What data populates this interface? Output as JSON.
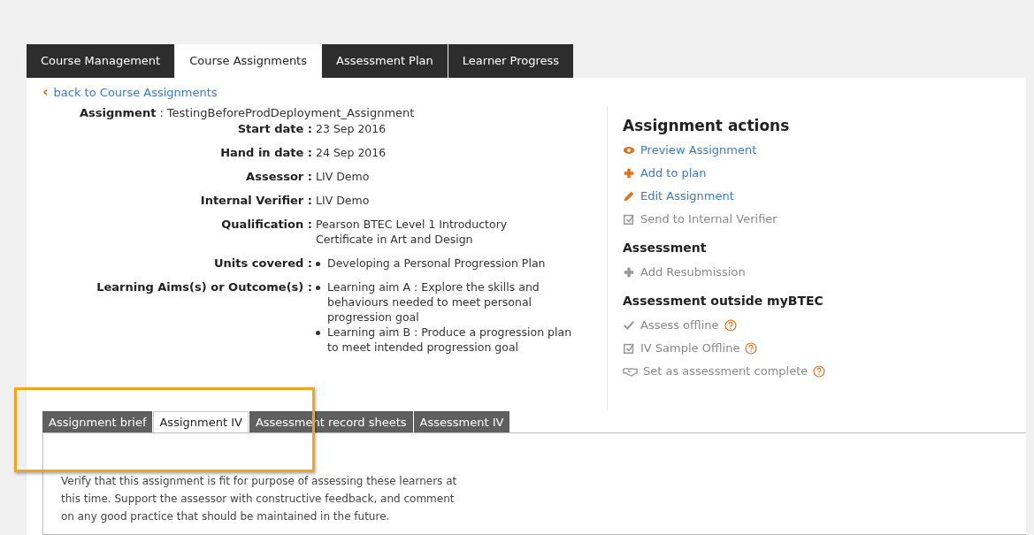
{
  "main_tabs": [
    {
      "label": "Course Management",
      "selected": false
    },
    {
      "label": "Course Assignments",
      "selected": true
    },
    {
      "label": "Assessment Plan",
      "selected": false
    },
    {
      "label": "Learner Progress",
      "selected": false
    }
  ],
  "back_link": {
    "icon": "‹",
    "label": "back to Course Assignments"
  },
  "assignment": {
    "label": "Assignment",
    "separator": ":",
    "value": "TestingBeforeProdDeployment_Assignment"
  },
  "details": [
    {
      "label": "Start date",
      "separator": ":",
      "value": "23 Sep 2016",
      "kind": "text"
    },
    {
      "label": "Hand in date",
      "separator": ":",
      "value": "24 Sep 2016",
      "kind": "text"
    },
    {
      "label": "Assessor",
      "separator": ":",
      "value": "LIV Demo",
      "kind": "text"
    },
    {
      "label": "Internal Verifier",
      "separator": ":",
      "value": "LIV Demo",
      "kind": "text"
    },
    {
      "label": "Qualification",
      "separator": ":",
      "value": "Pearson BTEC Level 1 Introductory Certificate in Art and Design",
      "kind": "text"
    },
    {
      "label": "Units covered",
      "separator": ":",
      "items": [
        "Developing a Personal Progression Plan"
      ],
      "kind": "list"
    },
    {
      "label": "Learning Aims(s) or Outcome(s)",
      "separator": ":",
      "items": [
        "Learning aim A : Explore the skills and behaviours needed to meet personal progression goal",
        "Learning aim B : Produce a progression plan to meet intended progression goal"
      ],
      "kind": "list"
    }
  ],
  "actions_sections": [
    {
      "title": "Assignment actions",
      "items": [
        {
          "label": "Preview Assignment",
          "kind": "eye",
          "disabled": false,
          "help": false
        },
        {
          "label": "Add to plan",
          "kind": "plus",
          "disabled": false,
          "help": false
        },
        {
          "label": "Edit Assignment",
          "kind": "pencil",
          "disabled": false,
          "help": false
        },
        {
          "label": "Send to Internal Verifier",
          "kind": "checkbox",
          "disabled": true,
          "help": false
        }
      ]
    },
    {
      "title": "Assessment",
      "items": [
        {
          "label": "Add Resubmission",
          "kind": "plus",
          "disabled": true,
          "help": false
        }
      ]
    },
    {
      "title": "Assessment outside myBTEC",
      "items": [
        {
          "label": "Assess offline",
          "kind": "check",
          "disabled": true,
          "help": true
        },
        {
          "label": "IV Sample Offline",
          "kind": "checkbox",
          "disabled": true,
          "help": true
        },
        {
          "label": "Set as assessment complete",
          "kind": "handshake",
          "disabled": true,
          "help": true
        }
      ]
    }
  ],
  "sub_tabs": [
    {
      "label": "Assignment brief",
      "selected": false
    },
    {
      "label": "Assignment IV",
      "selected": true
    },
    {
      "label": "Assessment record sheets",
      "selected": false
    },
    {
      "label": "Assessment IV",
      "selected": false
    }
  ],
  "tab_content": "Verify that this assignment is fit for purpose of assessing these learners at this time. Support the assessor with constructive feedback, and comment on any good practice that should be maintained in the future."
}
